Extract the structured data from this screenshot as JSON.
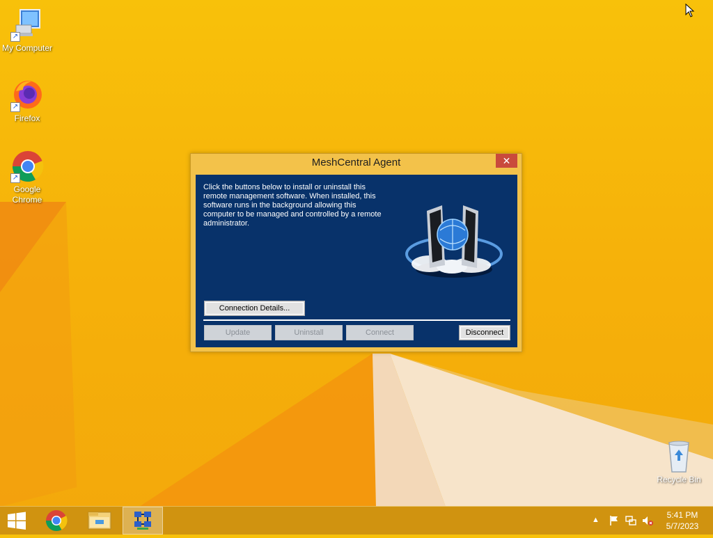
{
  "desktop": {
    "icons": [
      {
        "label": "My Computer"
      },
      {
        "label": "Firefox"
      },
      {
        "label": "Google\nChrome"
      },
      {
        "label": "Recycle Bin"
      }
    ]
  },
  "dialog": {
    "title": "MeshCentral Agent",
    "close_glyph": "✕",
    "description": "Click the buttons below to install or uninstall this remote management software. When installed, this software runs in the background allowing this computer to be managed and controlled by a remote administrator.",
    "buttons": {
      "connection_details": "Connection Details...",
      "update": "Update",
      "uninstall": "Uninstall",
      "connect": "Connect",
      "disconnect": "Disconnect"
    }
  },
  "taskbar": {
    "time": "5:41 PM",
    "date": "5/7/2023"
  },
  "colors": {
    "dialog_body": "#08326a",
    "dialog_frame": "#f3c24a",
    "close_button": "#c94a3c",
    "wallpaper": "#f6b10a"
  }
}
